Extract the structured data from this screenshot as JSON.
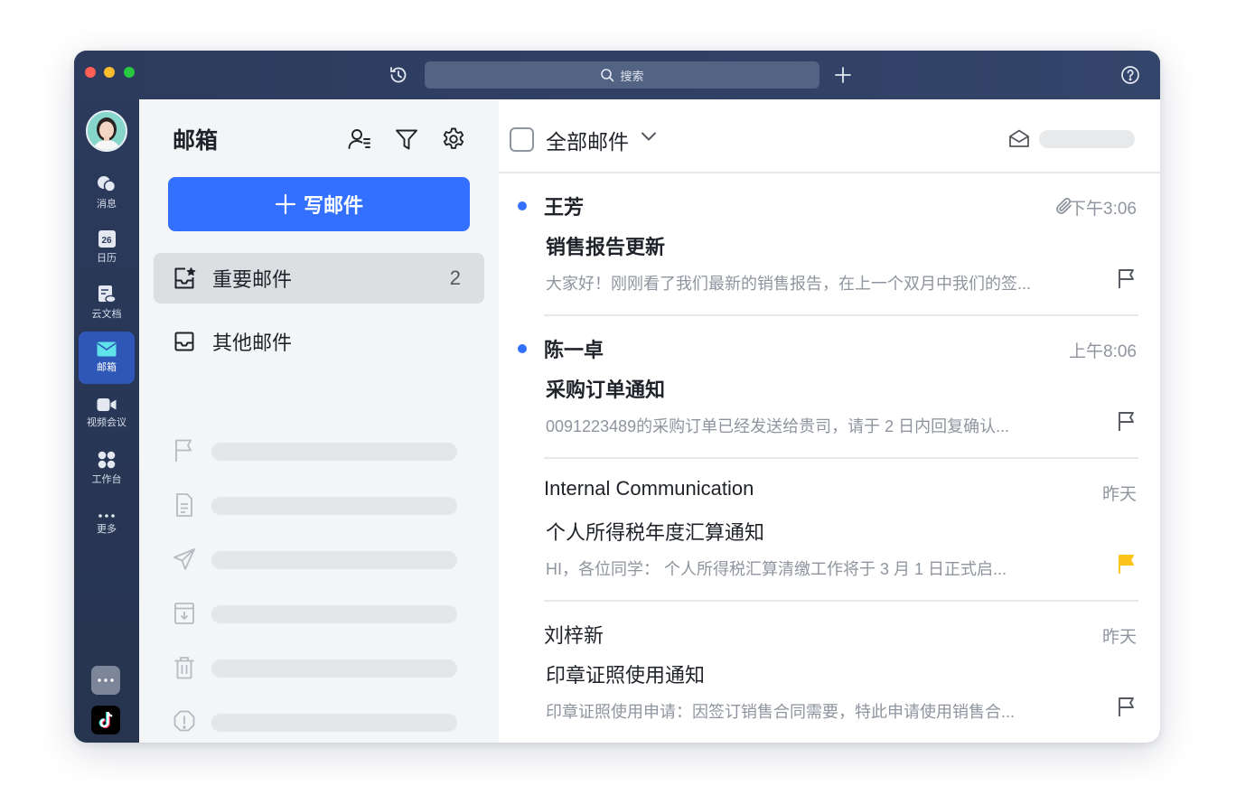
{
  "titlebar": {
    "search_placeholder": "搜索"
  },
  "rail": {
    "items": [
      {
        "label": "消息"
      },
      {
        "label": "日历",
        "badge": "26"
      },
      {
        "label": "云文档"
      },
      {
        "label": "邮箱"
      },
      {
        "label": "视频会议"
      },
      {
        "label": "工作台"
      },
      {
        "label": "更多"
      }
    ]
  },
  "sidebar": {
    "title": "邮箱",
    "compose_label": "写邮件",
    "folders": [
      {
        "label": "重要邮件",
        "count": "2"
      },
      {
        "label": "其他邮件"
      }
    ]
  },
  "main": {
    "filter_label": "全部邮件",
    "mails": [
      {
        "sender": "王芳",
        "time": "下午3:06",
        "subject": "销售报告更新",
        "preview": "大家好！刚刚看了我们最新的销售报告，在上一个双月中我们的签..."
      },
      {
        "sender": "陈一卓",
        "time": "上午8:06",
        "subject": "采购订单通知",
        "preview": "0091223489的采购订单已经发送给贵司，请于 2 日内回复确认..."
      },
      {
        "sender": "Internal Communication",
        "time": "昨天",
        "subject": "个人所得税年度汇算通知",
        "preview": "HI，各位同学：  个人所得税汇算清缴工作将于 3 月 1 日正式启..."
      },
      {
        "sender": "刘梓新",
        "time": "昨天",
        "subject": "印章证照使用通知",
        "preview": "印章证照使用申请：因签订销售合同需要，特此申请使用销售合..."
      }
    ]
  },
  "colors": {
    "accent": "#3370ff",
    "flag_yellow": "#fcc419",
    "rail_bg": "#2b3a5c"
  }
}
